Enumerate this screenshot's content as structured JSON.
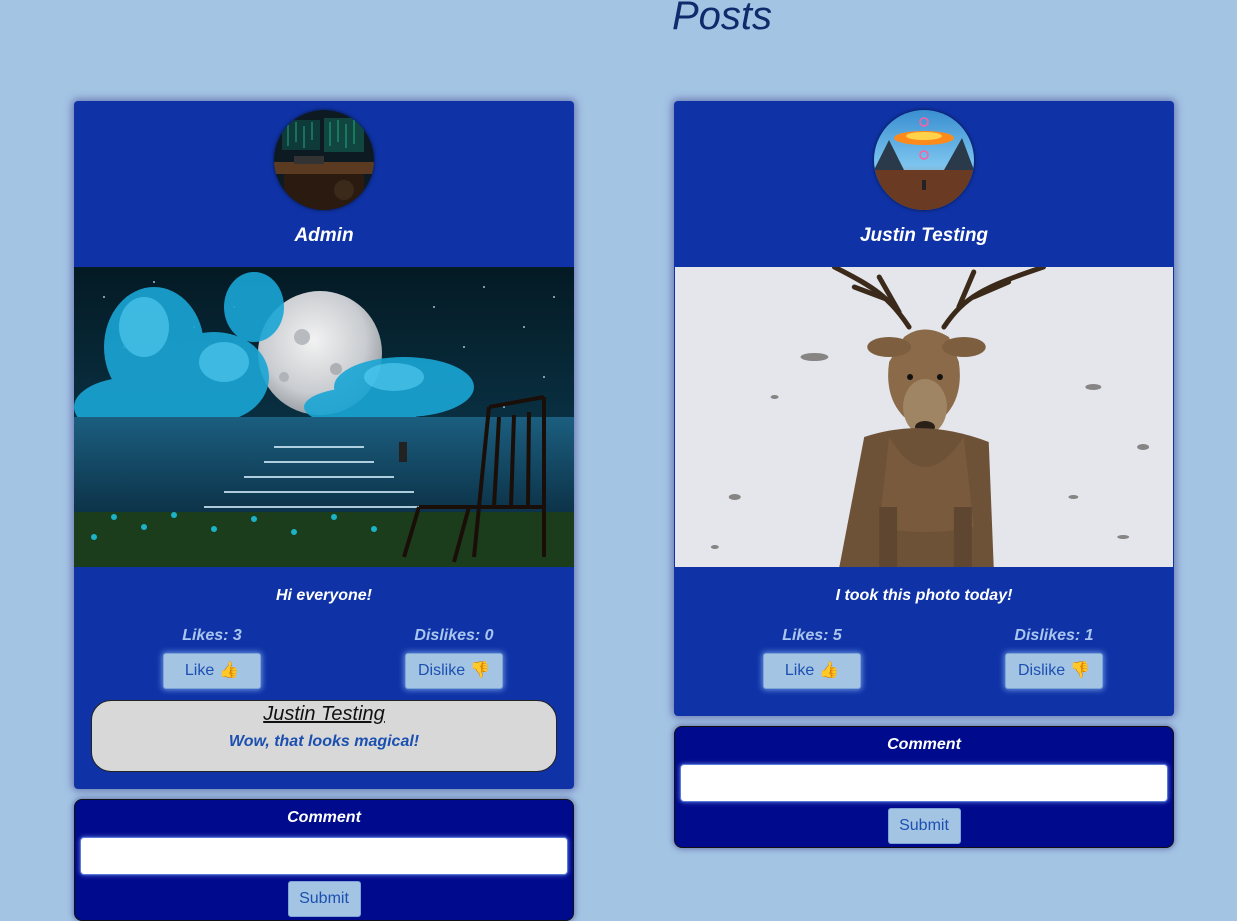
{
  "page": {
    "title": "Posts"
  },
  "posts": [
    {
      "author": "Admin",
      "caption": "Hi everyone!",
      "likes_text": "Likes: 3",
      "dislikes_text": "Dislikes: 0",
      "like_label": "Like",
      "dislike_label": "Dislike",
      "like_icon": "👍",
      "dislike_icon": "👎",
      "comments": [
        {
          "author": "Justin Testing",
          "text": "Wow, that looks magical!"
        }
      ],
      "comment_form": {
        "label": "Comment",
        "value": "",
        "submit_label": "Submit"
      }
    },
    {
      "author": "Justin Testing",
      "caption": "I took this photo today!",
      "likes_text": "Likes: 5",
      "dislikes_text": "Dislikes: 1",
      "like_label": "Like",
      "dislike_label": "Dislike",
      "like_icon": "👍",
      "dislike_icon": "👎",
      "comments": [],
      "comment_form": {
        "label": "Comment",
        "value": "",
        "submit_label": "Submit"
      }
    }
  ],
  "colors": {
    "background": "#a4c4e4",
    "card": "#0f33a6",
    "comment_form": "#000a8c",
    "button": "#a4c4e4",
    "accent_text": "#1c50b0"
  }
}
